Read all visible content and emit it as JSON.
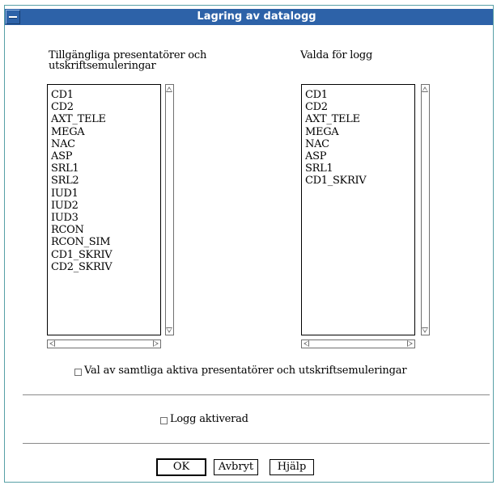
{
  "window": {
    "title": "Lagring av datalogg"
  },
  "available": {
    "label_line1": "Tillgängliga presentatörer och",
    "label_line2": "utskriftsemuleringar",
    "items": [
      "CD1",
      "CD2",
      "AXT_TELE",
      "MEGA",
      "NAC",
      "ASP",
      "SRL1",
      "SRL2",
      "IUD1",
      "IUD2",
      "IUD3",
      "RCON",
      "RCON_SIM",
      "CD1_SKRIV",
      "CD2_SKRIV"
    ]
  },
  "selected": {
    "label": "Valda för logg",
    "items": [
      "CD1",
      "CD2",
      "AXT_TELE",
      "MEGA",
      "NAC",
      "ASP",
      "SRL1",
      "CD1_SKRIV"
    ]
  },
  "select_all": {
    "label": "Val av samtliga aktiva presentatörer och utskriftsemuleringar",
    "checked": false
  },
  "log_enabled": {
    "label": "Logg aktiverad",
    "checked": false
  },
  "buttons": {
    "ok": "OK",
    "cancel": "Avbryt",
    "help": "Hjälp"
  }
}
